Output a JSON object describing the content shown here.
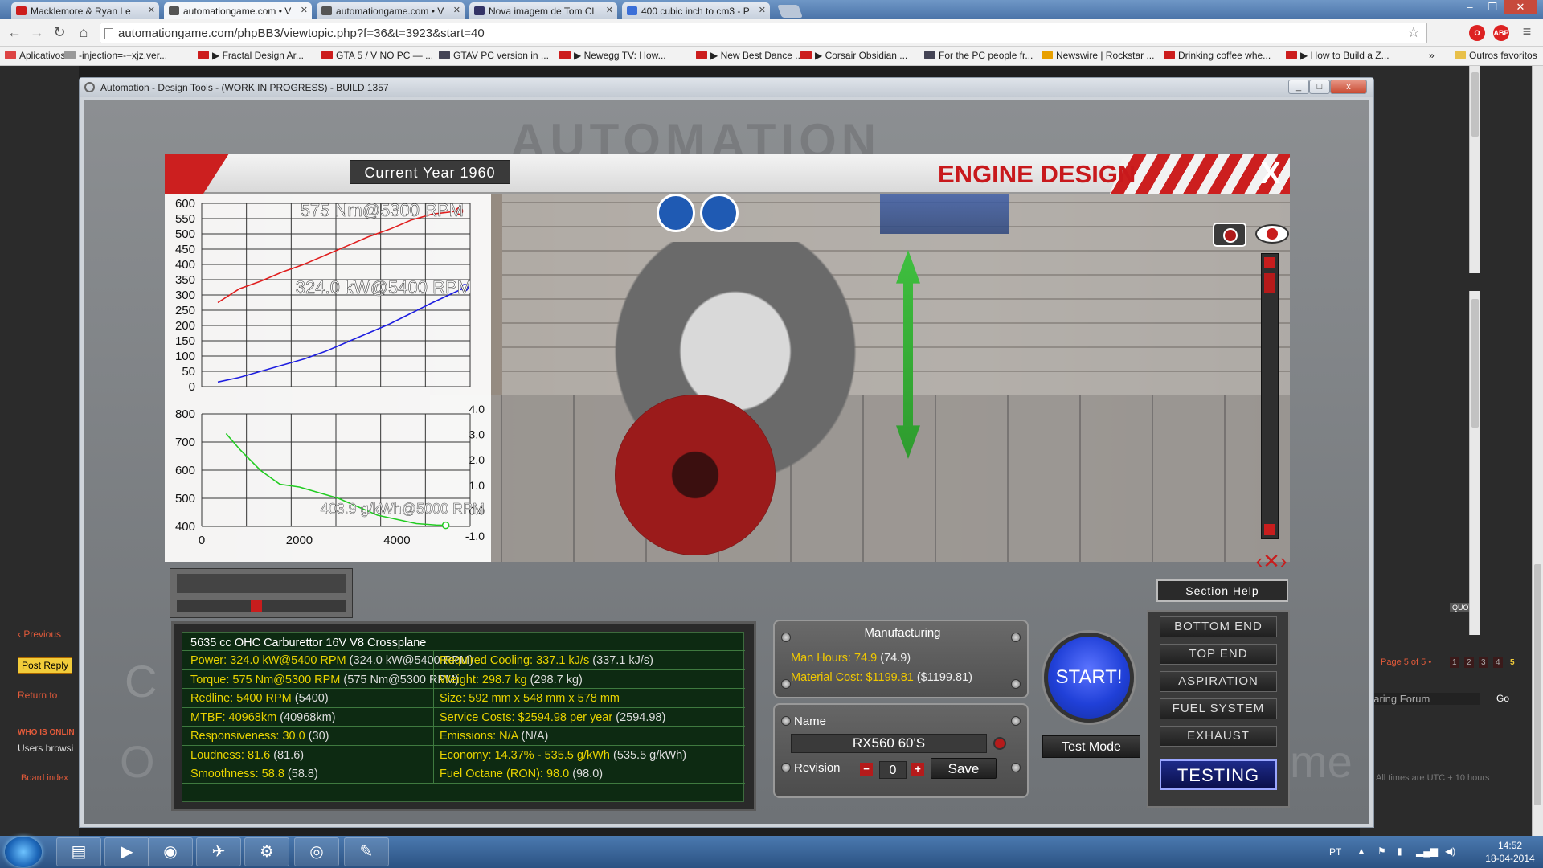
{
  "browser": {
    "tabs": [
      {
        "title": "Macklemore & Ryan Le",
        "icon_color": "#cc1d1d"
      },
      {
        "title": "automationgame.com • V",
        "icon_color": "#555555",
        "active": true
      },
      {
        "title": "automationgame.com • V",
        "icon_color": "#555555"
      },
      {
        "title": "Nova imagem de Tom Cl",
        "icon_color": "#333366"
      },
      {
        "title": "400 cubic inch to cm3 - P",
        "icon_color": "#3b6fd8"
      }
    ],
    "url": "automationgame.com/phpBB3/viewtopic.php?f=36&t=3923&start=40",
    "toolbar_icons": [
      "star-icon",
      "opera-icon",
      "adblock-icon",
      "menu-icon"
    ],
    "bookmarks": [
      {
        "label": "Aplicativos",
        "icon_color": "#d44"
      },
      {
        "label": "-injection=-+xjz.ver...",
        "icon_color": "#999"
      },
      {
        "label": "▶ Fractal Design Ar...",
        "icon_color": "#cc1d1d"
      },
      {
        "label": "GTA 5 / V NO PC — ...",
        "icon_color": "#cc1d1d"
      },
      {
        "label": "GTAV PC version in ...",
        "icon_color": "#445"
      },
      {
        "label": "▶ Newegg TV: How...",
        "icon_color": "#cc1d1d"
      },
      {
        "label": "▶ New Best Dance ...",
        "icon_color": "#cc1d1d"
      },
      {
        "label": "▶ Corsair Obsidian ...",
        "icon_color": "#cc1d1d"
      },
      {
        "label": "For the PC people fr...",
        "icon_color": "#445"
      },
      {
        "label": "Newswire | Rockstar ...",
        "icon_color": "#e8a000"
      },
      {
        "label": "Drinking coffee whe...",
        "icon_color": "#cc1d1d"
      },
      {
        "label": "▶ How to Build a Z...",
        "icon_color": "#cc1d1d"
      }
    ],
    "bookmarks_more": "»",
    "other_bookmarks": "Outros favoritos"
  },
  "forum": {
    "previous": "‹ Previous",
    "post_reply": "Post Reply",
    "return_to": "Return to",
    "who_is_online": "WHO IS ONLIN",
    "users_browsing": "Users browsi",
    "board_index": "Board index",
    "quote": "QUOTE",
    "page_info": "Page 5 of 5 •",
    "page_numbers": [
      "1",
      "2",
      "3",
      "4",
      "5"
    ],
    "forum_jump": "haring Forum",
    "go": "Go",
    "times": "All times are UTC + 10 hours"
  },
  "game": {
    "window_title": "Automation - Design Tools - (WORK IN PROGRESS) - BUILD 1357",
    "window_buttons": [
      "_",
      "□",
      "x"
    ],
    "current_year": "Current Year 1960",
    "section_title": "ENGINE DESIGN",
    "close": "X",
    "section_help": "Section Help",
    "menu": [
      "BOTTOM END",
      "TOP END",
      "ASPIRATION",
      "FUEL SYSTEM",
      "EXHAUST",
      "TESTING"
    ],
    "start": "START!",
    "test_mode": "Test Mode",
    "manufacturing": {
      "title": "Manufacturing",
      "man_hours": "Man Hours: 74.9",
      "man_hours_paren": "(74.9)",
      "material_cost": "Material Cost: $1199.81",
      "material_cost_paren": "($1199.81)"
    },
    "name_label": "Name",
    "name_value": "RX560 60'S",
    "revision_label": "Revision",
    "revision_value": "0",
    "save": "Save",
    "stats_header": "5635 cc OHC Carburettor 16V V8 Crossplane",
    "stats_left": [
      {
        "label": "Power: 324.0 kW@5400 RPM",
        "paren": "(324.0 kW@5400 RPM)"
      },
      {
        "label": "Torque: 575 Nm@5300 RPM",
        "paren": "(575 Nm@5300 RPM)"
      },
      {
        "label": "Redline: 5400 RPM",
        "paren": "(5400)"
      },
      {
        "label": "MTBF: 40968km",
        "paren": "(40968km)"
      },
      {
        "label": "Responsiveness: 30.0",
        "paren": "(30)"
      },
      {
        "label": "Loudness: 81.6",
        "paren": "(81.6)"
      },
      {
        "label": "Smoothness: 58.8",
        "paren": "(58.8)"
      }
    ],
    "stats_right": [
      {
        "label": "Required Cooling: 337.1 kJ/s",
        "paren": "(337.1 kJ/s)"
      },
      {
        "label": "Weight: 298.7 kg",
        "paren": "(298.7 kg)"
      },
      {
        "label": "Size: 592 mm x 548 mm x 578 mm",
        "paren": ""
      },
      {
        "label": "Service Costs: $2594.98 per year",
        "paren": "(2594.98)"
      },
      {
        "label": "Emissions: N/A",
        "paren": "(N/A)"
      },
      {
        "label": "Economy: 14.37% - 535.5 g/kWh",
        "paren": "(535.5 g/kWh)"
      },
      {
        "label": "Fuel Octane (RON): 98.0",
        "paren": "(98.0)"
      }
    ]
  },
  "chart_data": [
    {
      "type": "line",
      "title": "",
      "y_ticks": [
        "600",
        "550",
        "500",
        "450",
        "400",
        "350",
        "300",
        "250",
        "200",
        "150",
        "100",
        "50",
        "0"
      ],
      "ylim": [
        0,
        600
      ],
      "xlim": [
        500,
        5500
      ],
      "annotations": [
        "575 Nm@5300 RPM",
        "324.0 kW@5400 RPM"
      ],
      "series": [
        {
          "color": "#e01e1e",
          "x": [
            800,
            1200,
            1600,
            2000,
            2400,
            2800,
            3200,
            3600,
            4000,
            4400,
            4800,
            5300
          ],
          "y": [
            275,
            320,
            345,
            375,
            400,
            430,
            460,
            490,
            515,
            545,
            565,
            575
          ]
        },
        {
          "color": "#1e1ee0",
          "x": [
            800,
            1200,
            1600,
            2000,
            2400,
            2800,
            3200,
            3600,
            4000,
            4400,
            4800,
            5400
          ],
          "y": [
            15,
            30,
            50,
            70,
            90,
            115,
            145,
            175,
            205,
            240,
            275,
            324
          ]
        }
      ]
    },
    {
      "type": "line",
      "y_ticks": [
        "800",
        "700",
        "600",
        "500",
        "400"
      ],
      "y2_ticks": [
        "4.0",
        "3.0",
        "2.0",
        "1.0",
        "0.0",
        "-1.0"
      ],
      "x_ticks": [
        "0",
        "2000",
        "4000"
      ],
      "ylim": [
        400,
        800
      ],
      "xlim": [
        0,
        5500
      ],
      "annotations": [
        "403.9 g/kWh@5000 RPM"
      ],
      "series": [
        {
          "color": "#22cc22",
          "x": [
            500,
            800,
            1200,
            1600,
            2000,
            2400,
            2800,
            3200,
            3600,
            4000,
            4400,
            4800,
            5000
          ],
          "y": [
            730,
            670,
            600,
            550,
            540,
            520,
            500,
            470,
            440,
            425,
            410,
            405,
            403.9
          ]
        }
      ]
    }
  ],
  "taskbar": {
    "apps": [
      "folder-icon",
      "media-player-icon",
      "chrome-icon",
      "plane-icon",
      "steam-icon",
      "game-icon",
      "automation-icon"
    ],
    "lang": "PT",
    "time": "14:52",
    "date": "18-04-2014"
  }
}
